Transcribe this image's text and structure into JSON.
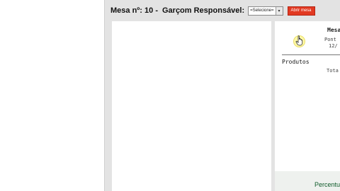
{
  "header": {
    "mesa_title": "Mesa nº: 10 -",
    "garcom_label": "Garçom Responsável:",
    "garcom_select_value": "=Selecione=",
    "abrir_button_label": "Abrir mesa"
  },
  "order_panel": {
    "mesa_heading": "Mesa",
    "pont_text": "Pont",
    "time_text": "12/",
    "produtos_label": "Produtos",
    "total_label": "Tota"
  },
  "footer": {
    "percent_label": "Percentu"
  },
  "colors": {
    "frame_bg": "#e3e3e3",
    "button_red": "#e23a22",
    "footer_text_green": "#0e5b2a"
  },
  "icons": {
    "select_arrow": "chevron-down-icon",
    "cursor": "hand-pointer-icon"
  }
}
